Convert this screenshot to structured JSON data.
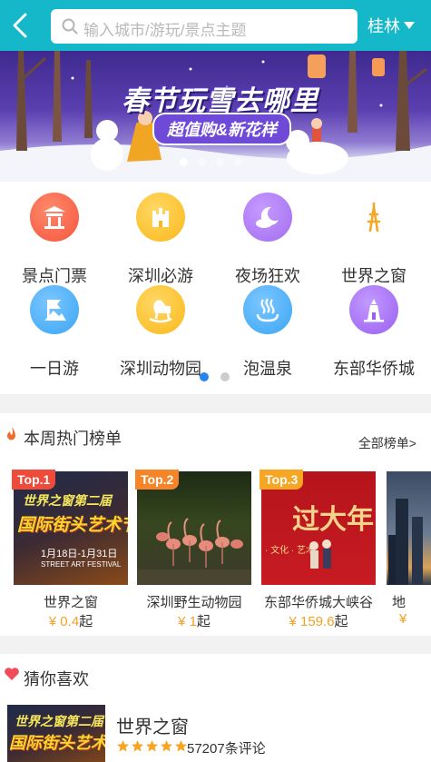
{
  "header": {
    "search_placeholder": "输入城市/游玩/景点主题",
    "city": "桂林",
    "theme_color": "#14b8c9"
  },
  "banner": {
    "title": "春节玩雪去哪里",
    "subtitle": "超值购&新花样",
    "slide_count": 4,
    "active_slide": 1
  },
  "categories": {
    "items": [
      {
        "label": "景点门票",
        "icon": "ticket-gate-icon",
        "color": "#f5553e"
      },
      {
        "label": "深圳必游",
        "icon": "castle-icon",
        "color": "#fbb81b"
      },
      {
        "label": "夜场狂欢",
        "icon": "moon-cloud-icon",
        "color": "#a36cf0"
      },
      {
        "label": "世界之窗",
        "icon": "tower-icon",
        "color": "#f5a623"
      },
      {
        "label": "一日游",
        "icon": "flag-mountain-icon",
        "color": "#3aa6f3"
      },
      {
        "label": "深圳动物园",
        "icon": "rocking-horse-icon",
        "color": "#fbb81b"
      },
      {
        "label": "泡温泉",
        "icon": "hot-spring-icon",
        "color": "#3aa6f3"
      },
      {
        "label": "东部华侨城",
        "icon": "lighthouse-icon",
        "color": "#9b5ff0"
      }
    ],
    "page_count": 2,
    "active_page": 1
  },
  "hot": {
    "title": "本周热门榜单",
    "more": "全部榜单>",
    "items": [
      {
        "badge": "Top.1",
        "name": "世界之窗",
        "price": "¥ 0.4",
        "suffix": "起",
        "badge_color": "#f04a3a"
      },
      {
        "badge": "Top.2",
        "name": "深圳野生动物园",
        "price": "¥ 1",
        "suffix": "起",
        "badge_color": "#f6852a"
      },
      {
        "badge": "Top.3",
        "name": "东部华侨城大峡谷",
        "price": "¥ 159.6",
        "suffix": "起",
        "badge_color": "#f6a623"
      },
      {
        "badge": "",
        "name": "地",
        "price": "¥",
        "suffix": "",
        "badge_color": ""
      }
    ],
    "poster1": {
      "line1": "世界之窗第二届",
      "line2": "国际街头艺术节",
      "dates": "1月18日-1月31日",
      "en": "STREET ART FESTIVAL"
    },
    "poster3": {
      "text": "过大年",
      "sub": "· 文化 · 艺术"
    }
  },
  "guess": {
    "title": "猜你喜欢",
    "item": {
      "name": "世界之窗",
      "rating": 5,
      "reviews": "57207条评论"
    }
  }
}
